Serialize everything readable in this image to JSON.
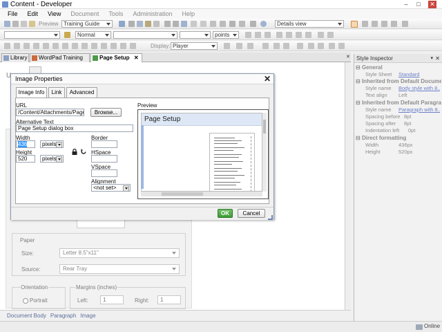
{
  "window": {
    "title": "Content - Developer",
    "buttons": {
      "minimize": "–",
      "maximize": "□",
      "close": "✕"
    }
  },
  "menu": [
    "File",
    "Edit",
    "View",
    "Document",
    "Tools",
    "Administration",
    "Help"
  ],
  "toolbar": {
    "preview_label": "Preview",
    "guide_select": "Training Guide",
    "view_select": "Details view",
    "style_select": "Normal",
    "units_select": "points",
    "display_label": "Display:",
    "display_select": "Player"
  },
  "doc_tabs": [
    {
      "label": "Library"
    },
    {
      "label": "WordPad Training"
    },
    {
      "label": "Page Setup",
      "close": "✕"
    }
  ],
  "background": {
    "letter": "U",
    "paper_label": "Paper",
    "size_label": "Size:",
    "size_value": "Letter 8.5\"x11\"",
    "source_label": "Source:",
    "source_value": "Rear Tray",
    "orientation_label": "Orientation",
    "portrait_label": "Portrait",
    "margins_label": "Margins (inches)",
    "left_label": "Left:",
    "left_value": "1",
    "right_label": "Right:",
    "right_value": "1"
  },
  "status_path": [
    "Document Body",
    "Paragraph",
    "Image"
  ],
  "inspector": {
    "title": "Style Inspector",
    "general": "General",
    "style_sheet_key": "Style Sheet",
    "style_sheet_val": "Standard",
    "inherited_doc": "Inherited from Default Document",
    "style_name_key": "Style name",
    "style_name_doc": "Body style with 8...",
    "text_align_key": "Text align",
    "text_align_val": "Left",
    "inherited_para": "Inherited from Default Paragraph",
    "style_name_para": "Paragraph with 8...",
    "spacing_before_key": "Spacing before",
    "spacing_before_val": "8pt",
    "spacing_after_key": "Spacing after",
    "spacing_after_val": "8pt",
    "indent_left_key": "Indentation left",
    "indent_left_val": "0pt",
    "direct": "Direct formatting",
    "width_key": "Width",
    "width_val": "436px",
    "height_key": "Height",
    "height_val": "520px"
  },
  "dialog": {
    "title": "Image Properties",
    "close": "✕",
    "tabs": [
      "Image Info",
      "Link",
      "Advanced"
    ],
    "url_label": "URL",
    "url_value": "/Content/Attachments/Page S",
    "browse_label": "Browse...",
    "alt_label": "Alternative Text",
    "alt_value": "Page Setup dialog box",
    "width_label": "Width",
    "width_value": "436",
    "width_unit": "pixels",
    "height_label": "Height",
    "height_value": "520",
    "height_unit": "pixels",
    "border_label": "Border",
    "hspace_label": "HSpace",
    "vspace_label": "VSpace",
    "alignment_label": "Alignment",
    "alignment_value": "<not set>",
    "preview_label": "Preview",
    "preview_heading": "Page Setup",
    "ok_label": "OK",
    "cancel_label": "Cancel"
  },
  "os_status": "Online"
}
